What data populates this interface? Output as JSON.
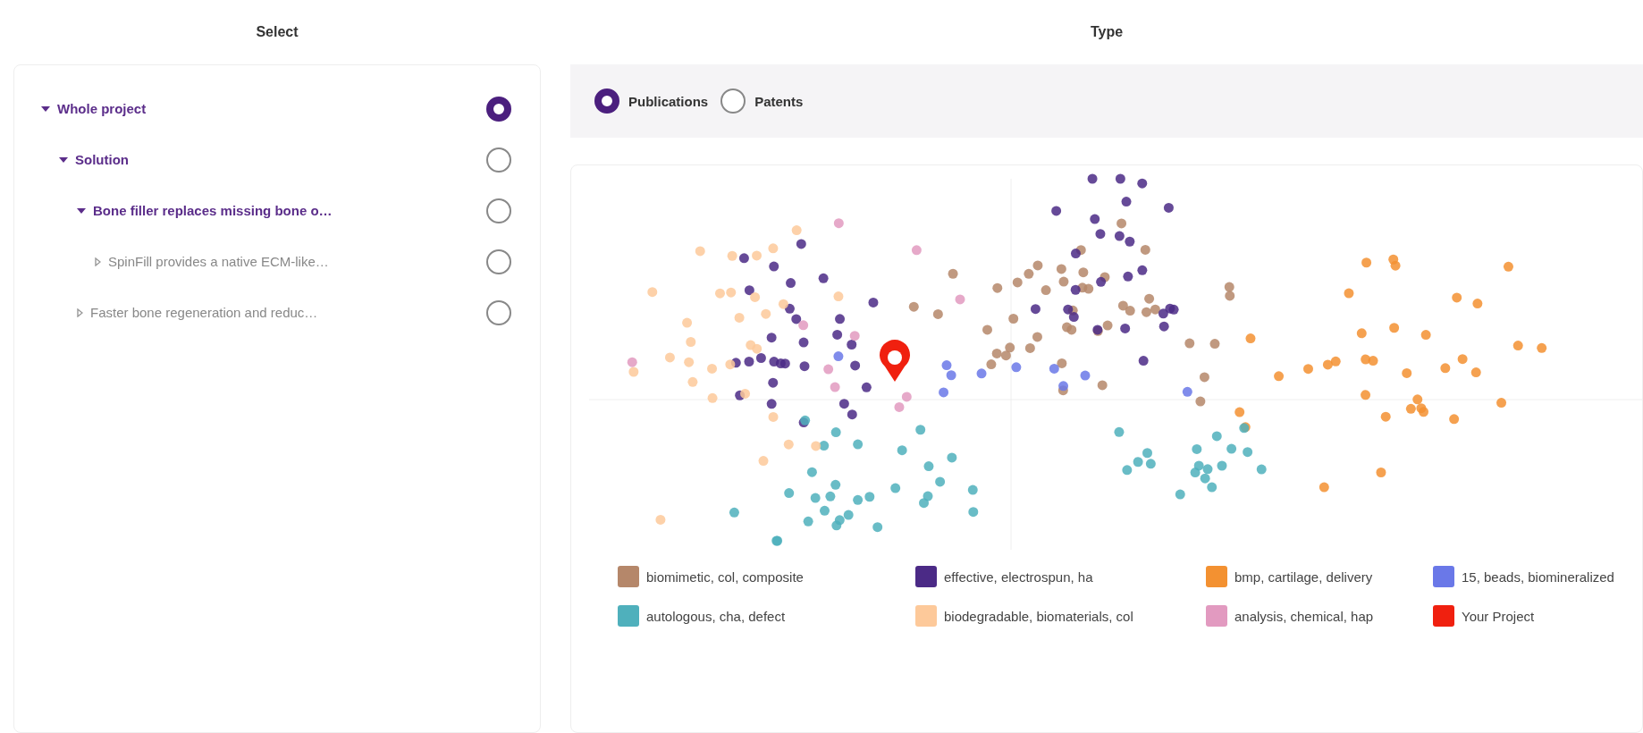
{
  "select": {
    "title": "Select",
    "tree": [
      {
        "label": "Whole project",
        "expanded": true,
        "selected": true,
        "children": [
          {
            "label": "Solution",
            "expanded": true,
            "selected": false,
            "children": [
              {
                "label": "Bone filler replaces missing bone o…",
                "expanded": true,
                "selected": false,
                "children": [
                  {
                    "label": "SpinFill provides a native ECM-like…",
                    "expanded": false,
                    "selected": false
                  }
                ]
              },
              {
                "label": "Faster bone regeneration and reduc…",
                "expanded": false,
                "selected": false
              }
            ]
          }
        ]
      }
    ]
  },
  "type": {
    "title": "Type",
    "options": [
      {
        "label": "Publications",
        "selected": true
      },
      {
        "label": "Patents",
        "selected": false
      }
    ]
  },
  "legend": [
    {
      "label": "biomimetic, col, composite",
      "color": "#b5876a"
    },
    {
      "label": "effective, electrospun, ha",
      "color": "#4b2a86"
    },
    {
      "label": "bmp, cartilage, delivery",
      "color": "#f39131"
    },
    {
      "label": "15, beads, biomineralized",
      "color": "#6a78e8"
    },
    {
      "label": "autologous, cha, defect",
      "color": "#4fb0bc"
    },
    {
      "label": "biodegradable, biomaterials, col",
      "color": "#fdc99a"
    },
    {
      "label": "analysis, chemical, hap",
      "color": "#e29ac0"
    },
    {
      "label": "Your Project",
      "color": "#f0200f"
    }
  ]
}
